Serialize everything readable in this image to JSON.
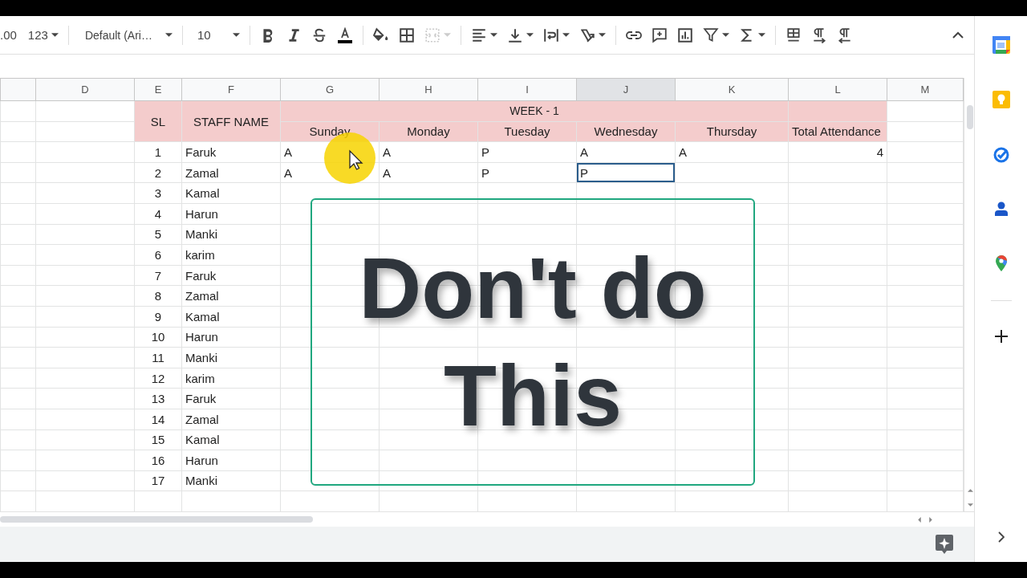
{
  "toolbar": {
    "decimal_button": ".00",
    "number_format": "123",
    "font": "Default (Ari…",
    "font_size": "10"
  },
  "columns": [
    {
      "label": "D",
      "selected": false
    },
    {
      "label": "E",
      "selected": false
    },
    {
      "label": "F",
      "selected": false
    },
    {
      "label": "G",
      "selected": false
    },
    {
      "label": "H",
      "selected": false
    },
    {
      "label": "I",
      "selected": false
    },
    {
      "label": "J",
      "selected": true
    },
    {
      "label": "K",
      "selected": false
    },
    {
      "label": "L",
      "selected": false
    },
    {
      "label": "M",
      "selected": false
    }
  ],
  "sheet": {
    "sl_header": "SL",
    "name_header": "STAFF NAME",
    "week_title": "WEEK - 1",
    "days": [
      "Sunday",
      "Monday",
      "Tuesday",
      "Wednesday",
      "Thursday"
    ],
    "total_header": "Total Attendance",
    "rows": [
      {
        "sl": "1",
        "name": "Faruk",
        "marks": [
          {
            "value": "A",
            "editing": false
          },
          {
            "value": "A",
            "editing": false
          },
          {
            "value": "P",
            "editing": false
          },
          {
            "value": "A",
            "editing": false
          },
          {
            "value": "A",
            "editing": false
          }
        ],
        "total": "4"
      },
      {
        "sl": "2",
        "name": "Zamal",
        "marks": [
          {
            "value": "A",
            "editing": false
          },
          {
            "value": "A",
            "editing": false
          },
          {
            "value": "P",
            "editing": false
          },
          {
            "value": "P",
            "editing": true
          }
        ]
      },
      {
        "sl": "3",
        "name": "Kamal"
      },
      {
        "sl": "4",
        "name": "Harun"
      },
      {
        "sl": "5",
        "name": "Manki"
      },
      {
        "sl": "6",
        "name": "karim"
      },
      {
        "sl": "7",
        "name": "Faruk"
      },
      {
        "sl": "8",
        "name": "Zamal"
      },
      {
        "sl": "9",
        "name": "Kamal"
      },
      {
        "sl": "10",
        "name": "Harun"
      },
      {
        "sl": "11",
        "name": "Manki"
      },
      {
        "sl": "12",
        "name": "karim"
      },
      {
        "sl": "13",
        "name": "Faruk"
      },
      {
        "sl": "14",
        "name": "Zamal"
      },
      {
        "sl": "15",
        "name": "Kamal"
      },
      {
        "sl": "16",
        "name": "Harun"
      },
      {
        "sl": "17",
        "name": "Manki"
      }
    ]
  },
  "overlay": {
    "lines": [
      "Don't do",
      "This"
    ]
  }
}
